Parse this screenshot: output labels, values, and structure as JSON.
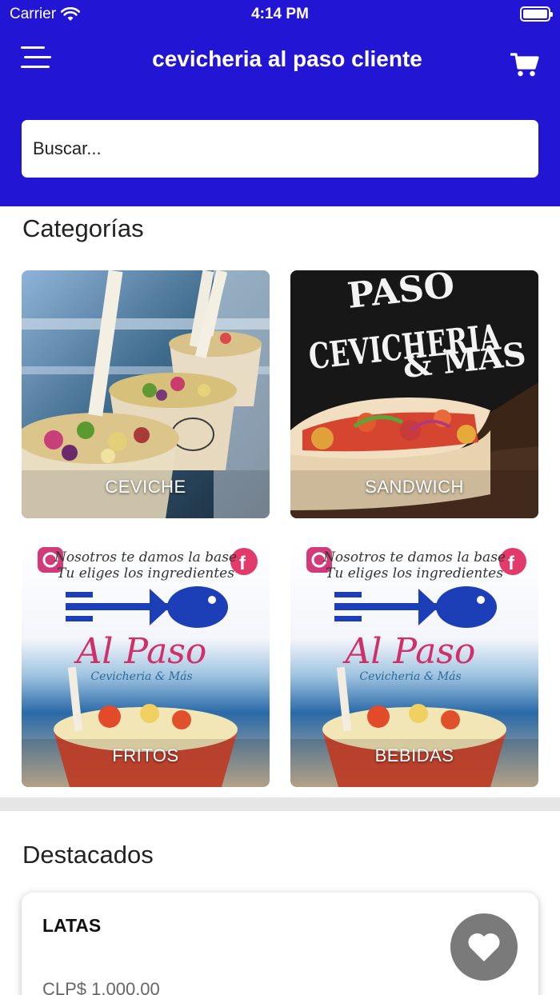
{
  "status_bar": {
    "carrier": "Carrier",
    "time": "4:14 PM"
  },
  "header": {
    "title": "cevicheria al paso cliente"
  },
  "search": {
    "placeholder": "Buscar..."
  },
  "categories": {
    "title": "Categorías",
    "items": [
      {
        "label": "CEVICHE"
      },
      {
        "label": "SANDWICH"
      },
      {
        "label": "FRITOS"
      },
      {
        "label": "BEBIDAS"
      }
    ],
    "signage": {
      "line1": "PASO",
      "line2": "CEVICHERIA",
      "line3": "& MAS"
    },
    "poster": {
      "line1": "Nosotros te damos la base",
      "line2": "Tu eliges los ingredientes",
      "brand": "Al Paso",
      "tagline": "Cevicheria & Más"
    }
  },
  "featured": {
    "title": "Destacados",
    "items": [
      {
        "name": "LATAS",
        "price": "CLP$ 1.000,00"
      }
    ]
  },
  "colors": {
    "brand": "#2215d4",
    "divider": "#e6e6e6",
    "fav_button": "#7a7a7a"
  }
}
